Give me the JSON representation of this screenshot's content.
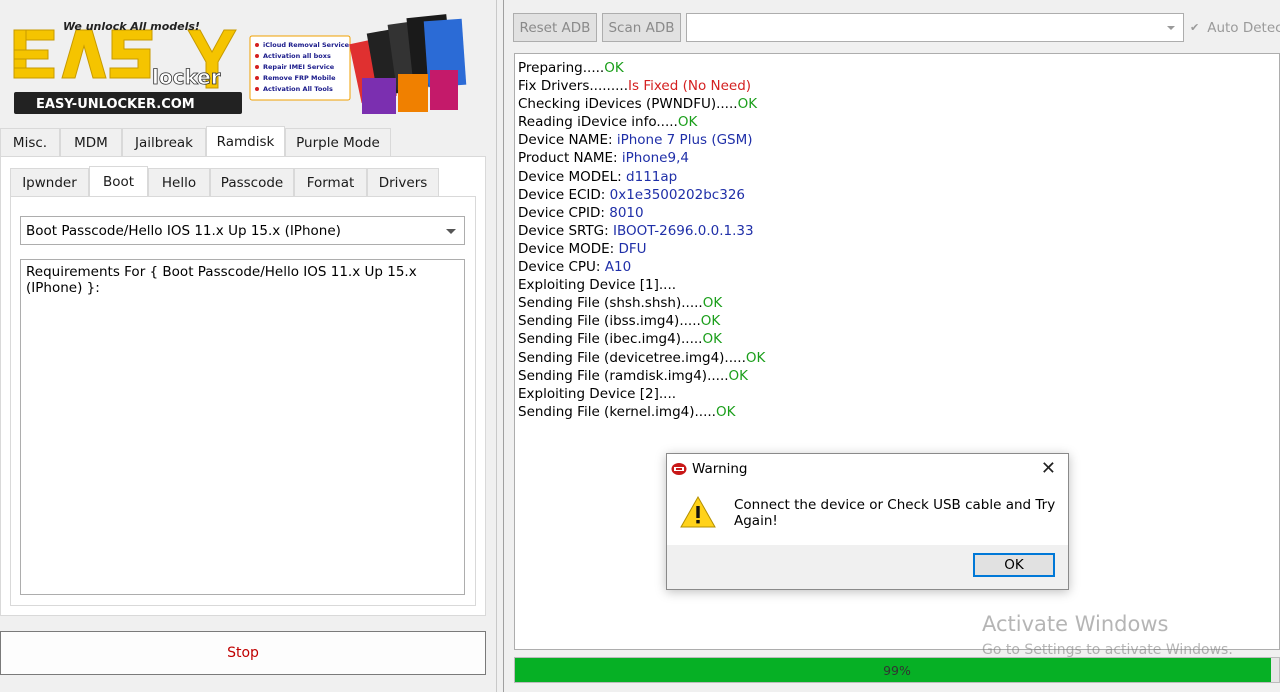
{
  "banner": {
    "tagline": "We unlock All models!",
    "logo_text": "EasY",
    "logo_sub": "locker",
    "site": "EASY-UNLOCKER.COM",
    "services": [
      "iCloud Removal Service",
      "Activation all boxs",
      "Repair IMEI Service",
      "Remove FRP Mobile",
      "Activation All Tools"
    ]
  },
  "tabs": [
    "Misc.",
    "MDM",
    "Jailbreak",
    "Ramdisk",
    "Purple Mode"
  ],
  "active_tab": "Ramdisk",
  "subtabs": [
    "Ipwnder",
    "Boot",
    "Hello",
    "Passcode",
    "Format",
    "Drivers"
  ],
  "active_subtab": "Boot",
  "mode_select": {
    "value": "Boot Passcode/Hello IOS 11.x Up 15.x (IPhone)"
  },
  "requirements": "Requirements For { Boot Passcode/Hello IOS 11.x Up 15.x (IPhone) }:",
  "stop_label": "Stop",
  "toolbar": {
    "reset_adb": "Reset ADB",
    "scan_adb": "Scan ADB",
    "auto_detect": "Auto Detect"
  },
  "log": [
    {
      "label": "Preparing.....",
      "value": "OK",
      "style": "ok"
    },
    {
      "label": "Fix Drivers.........",
      "value": "Is Fixed (No Need)",
      "style": "red"
    },
    {
      "label": "Checking iDevices (PWNDFU).....",
      "value": "OK",
      "style": "ok"
    },
    {
      "label": "Reading iDevice info.....",
      "value": "OK",
      "style": "ok"
    },
    {
      "label": "Device NAME: ",
      "value": "iPhone 7 Plus (GSM)",
      "style": "blue"
    },
    {
      "label": "Product NAME: ",
      "value": "iPhone9,4",
      "style": "blue"
    },
    {
      "label": "Device MODEL: ",
      "value": "d111ap",
      "style": "blue"
    },
    {
      "label": "Device ECID: ",
      "value": "0x1e3500202bc326",
      "style": "blue"
    },
    {
      "label": "Device CPID: ",
      "value": "8010",
      "style": "blue"
    },
    {
      "label": "Device SRTG: ",
      "value": "IBOOT-2696.0.0.1.33",
      "style": "blue"
    },
    {
      "label": "Device MODE: ",
      "value": "DFU",
      "style": "blue"
    },
    {
      "label": "Device CPU: ",
      "value": "A10",
      "style": "blue"
    },
    {
      "label": "Exploiting Device [1]....",
      "value": "",
      "style": "ok"
    },
    {
      "label": "Sending File (shsh.shsh).....",
      "value": "OK",
      "style": "ok"
    },
    {
      "label": "Sending File (ibss.img4).....",
      "value": "OK",
      "style": "ok"
    },
    {
      "label": "Sending File (ibec.img4).....",
      "value": "OK",
      "style": "ok"
    },
    {
      "label": "Sending File (devicetree.img4).....",
      "value": "OK",
      "style": "ok"
    },
    {
      "label": "Sending File (ramdisk.img4).....",
      "value": "OK",
      "style": "ok"
    },
    {
      "label": "Exploiting Device [2]....",
      "value": "",
      "style": "ok"
    },
    {
      "label": "Sending File (kernel.img4).....",
      "value": "OK",
      "style": "ok"
    }
  ],
  "progress": {
    "value": 0.99,
    "label": "99%"
  },
  "watermark": {
    "title": "Activate Windows",
    "subtitle": "Go to Settings to activate Windows."
  },
  "dialog": {
    "title": "Warning",
    "message": "Connect the device or Check USB cable and Try Again!",
    "ok_label": "OK",
    "close_glyph": "✕"
  },
  "colors": {
    "ok": "#1a9e1a",
    "error": "#d42020",
    "info": "#1f2fa8",
    "progress": "#06b025",
    "stop": "#c00000"
  }
}
